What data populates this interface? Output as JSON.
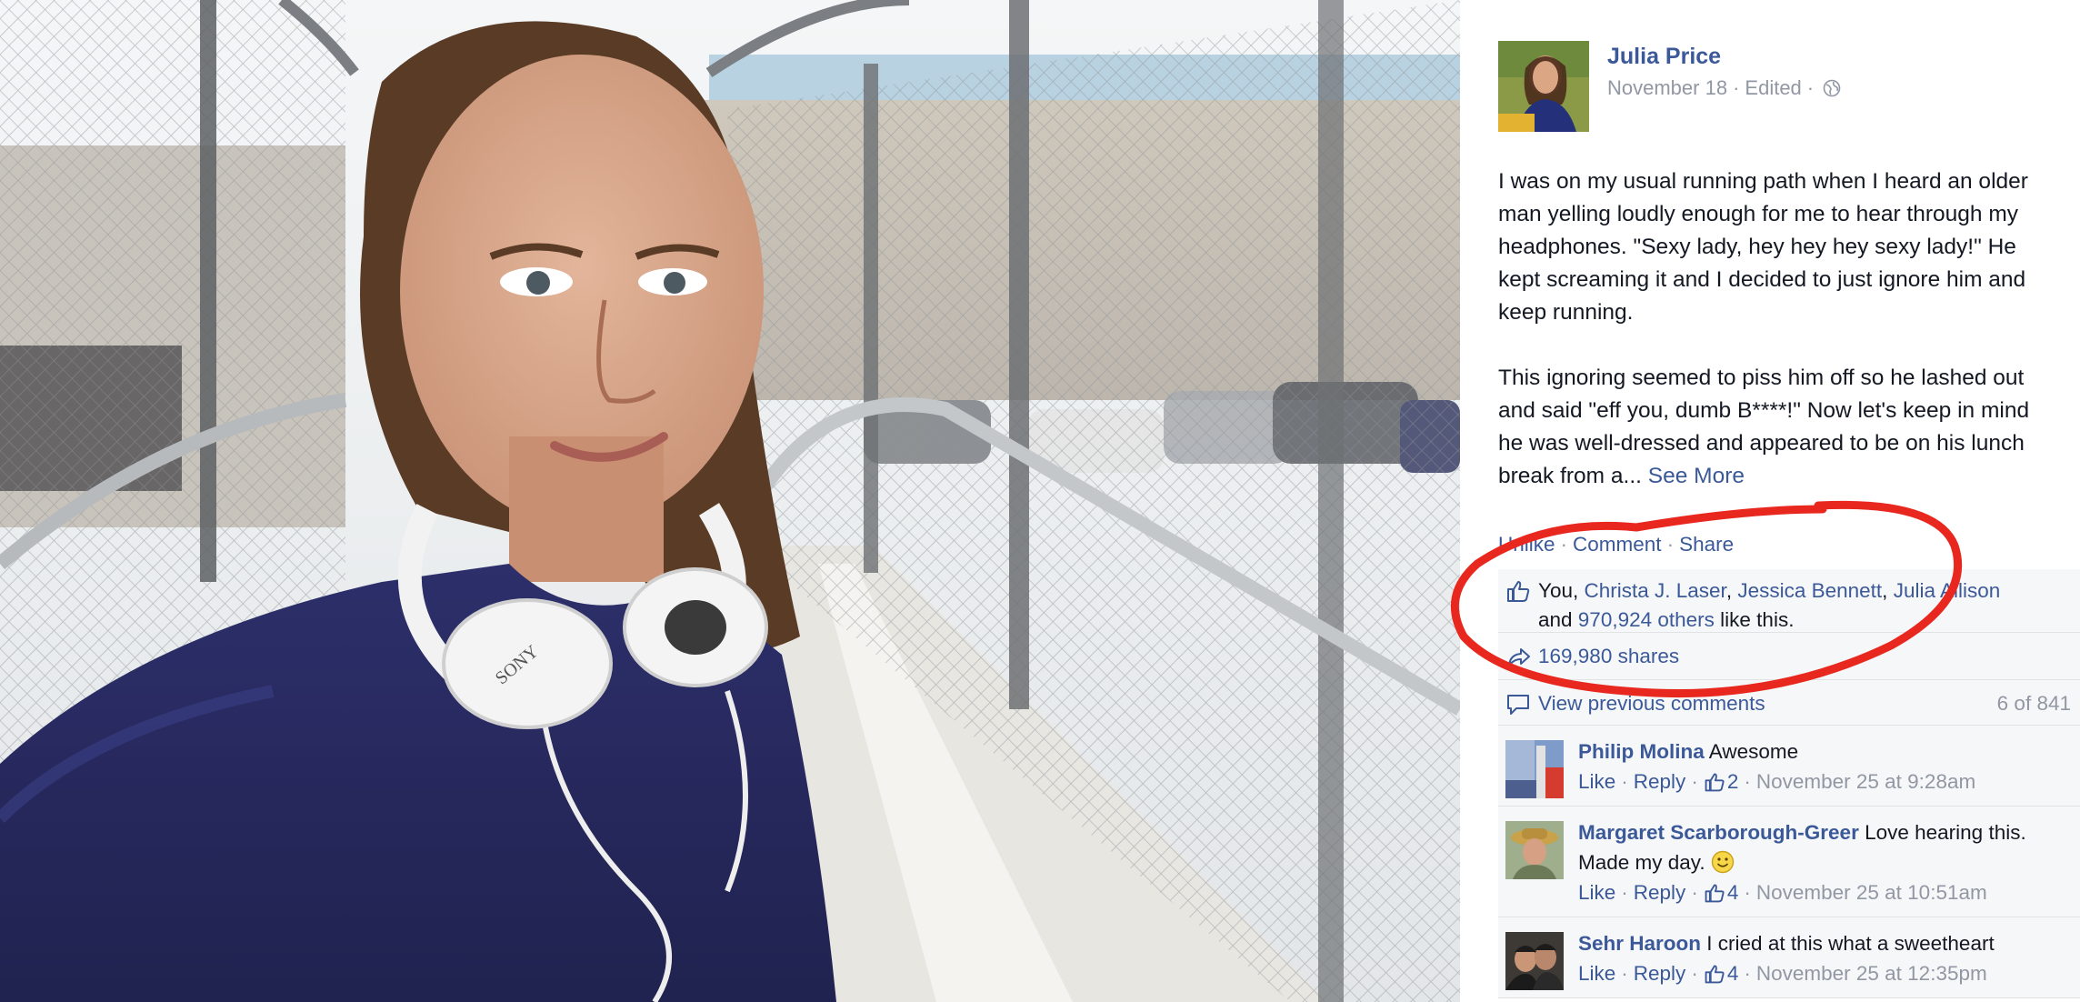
{
  "post": {
    "author": "Julia Price",
    "date": "November 18",
    "edited": "Edited",
    "meta_sep": "·",
    "paragraph1": "I was on my usual running path when I heard an older man yelling loudly enough for me to hear through my headphones. \"Sexy lady, hey hey hey sexy lady!\" He kept screaming it and I decided to just ignore him and keep running.",
    "paragraph2": "This ignoring seemed to piss him off so he lashed out and said \"eff you, dumb B****!\" Now let's keep in mind he was well-dressed and appeared to be on his lunch break from a... ",
    "see_more": "See More"
  },
  "actions": {
    "unlike": "Unlike",
    "comment": "Comment",
    "share": "Share",
    "sep": "·"
  },
  "likes": {
    "you": "You, ",
    "name1": "Christa J. Laser",
    "name2": "Jessica Bennett",
    "name3": "Julia Allison",
    "and": "and ",
    "others": "970,924 others",
    "like_this": " like this."
  },
  "shares": {
    "label": "169,980 shares"
  },
  "previous": {
    "label": "View previous comments",
    "count": "6 of 841"
  },
  "comments": [
    {
      "name": "Philip Molina",
      "text": "Awesome",
      "like": "Like",
      "reply": "Reply",
      "likes": "2",
      "time": "November 25 at 9:28am"
    },
    {
      "name": "Margaret Scarborough-Greer",
      "text": "Love hearing this. Made my day.",
      "like": "Like",
      "reply": "Reply",
      "likes": "4",
      "time": "November 25 at 10:51am"
    },
    {
      "name": "Sehr Haroon",
      "text": "I cried at this what a sweetheart",
      "like": "Like",
      "reply": "Reply",
      "likes": "4",
      "time": "November 25 at 12:35pm"
    }
  ],
  "photo": {
    "headphone_brand": "SONY"
  },
  "colors": {
    "link": "#3b5998",
    "meta": "#9197a3",
    "annotation": "#e8281f",
    "ufi_bg": "#f6f7f9"
  }
}
